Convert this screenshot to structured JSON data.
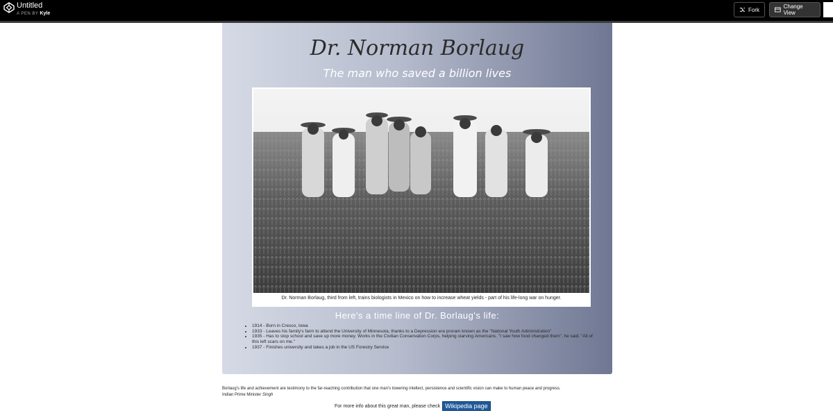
{
  "header": {
    "title": "Untitled",
    "byline_prefix": "A PEN BY",
    "author": "Kyle",
    "fork_label": "Fork",
    "change_view_label": "Change View"
  },
  "tribute": {
    "heading": "Dr. Norman Borlaug",
    "tagline": "The man who saved a billion lives",
    "image_caption": "Dr. Norman Borlaug, third from left, trains biologists in Mexico on how to increase wheat yields - part of his life-long war on hunger.",
    "timeline_heading": "Here's a time line of Dr. Borlaug's life:",
    "timeline": [
      "1914 - Born in Cresco, Iowa",
      "1933 - Leaves his family's farm to attend the University of Minnesota, thanks to a Depression era proram known as the \"National Youth Administration\"",
      "1935 - Has to stop school and save up more money. Works in the Civilian Conservation Corps, helping starving Americans. \"I saw how food changed them\", he said. \"All of this left scars on me.\"",
      "1937 - Finishes university and takes a job in the US Forestry Service"
    ]
  },
  "footer": {
    "quote": "Borlaug's life and achievement are testimony to the far-reaching contribution that one man's towering intellect, persistence and scientific vision can make to human peace and progress.",
    "quote_author_prefix": "Indian Prime Minister",
    "quote_author_name": "Singh",
    "more_info_text": "For more info about this great man, please check",
    "link_label": "Wikipedia page"
  },
  "colors": {
    "topbar": "#000000",
    "card_gradient_start": "#d6dae6",
    "card_gradient_end": "#6f7793",
    "link_background": "#1e5a9b"
  },
  "icons": [
    "codepen-logo-icon",
    "fork-icon",
    "change-view-icon",
    "corner-icon"
  ]
}
